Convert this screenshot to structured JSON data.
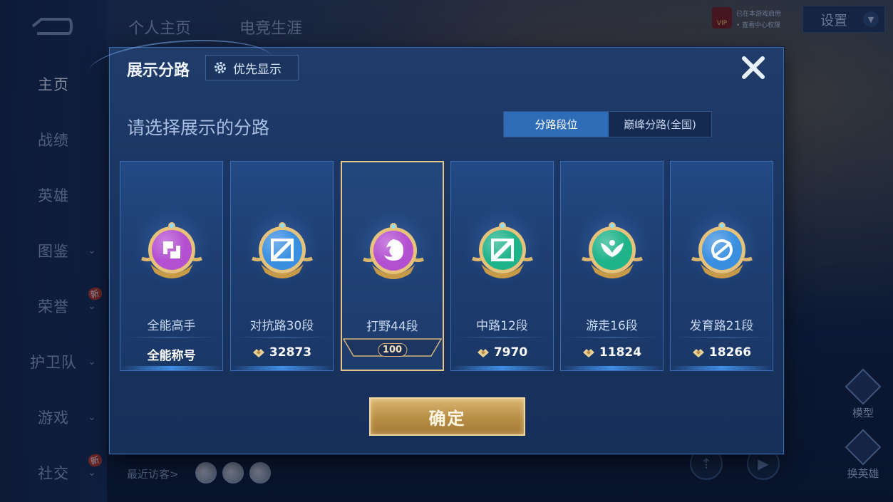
{
  "background": {
    "nav": {
      "items": [
        {
          "label": "主页",
          "active": true,
          "chevron": false,
          "new": false
        },
        {
          "label": "战绩",
          "active": false,
          "chevron": false,
          "new": false
        },
        {
          "label": "英雄",
          "active": false,
          "chevron": false,
          "new": false
        },
        {
          "label": "图鉴",
          "active": false,
          "chevron": true,
          "new": false
        },
        {
          "label": "荣誉",
          "active": false,
          "chevron": true,
          "new": true
        },
        {
          "label": "护卫队",
          "active": false,
          "chevron": true,
          "new": false
        },
        {
          "label": "游戏",
          "active": false,
          "chevron": true,
          "new": false
        },
        {
          "label": "社交",
          "active": false,
          "chevron": true,
          "new": true
        }
      ],
      "new_badge": "新"
    },
    "top_tabs": [
      "个人主页",
      "电竞生涯"
    ],
    "settings_label": "设置",
    "vip": {
      "badge": "VIP",
      "line1": "已在本游戏启用",
      "line2": "• 查看中心权限"
    },
    "recent_visitors_label": "最近访客>",
    "right_buttons": {
      "model": "模型",
      "switch_hero": "换英雄"
    }
  },
  "modal": {
    "title": "展示分路",
    "priority_button": "优先显示",
    "subtitle": "请选择展示的分路",
    "segments": {
      "active": "分路段位",
      "inactive": "巅峰分路(全国)"
    },
    "cards": [
      {
        "name": "全能高手",
        "footer": "全能称号",
        "has_gem": false,
        "selected": false,
        "icon": "allround-icon",
        "color": "#b34fd1"
      },
      {
        "name": "对抗路30段",
        "footer": "32873",
        "has_gem": true,
        "selected": false,
        "icon": "clash-lane-icon",
        "color": "#3a8fe0"
      },
      {
        "name": "打野44段",
        "footer": "100",
        "has_gem": false,
        "selected": true,
        "icon": "jungle-icon",
        "color": "#b34fd1"
      },
      {
        "name": "中路12段",
        "footer": "7970",
        "has_gem": true,
        "selected": false,
        "icon": "mid-lane-icon",
        "color": "#1fb38a"
      },
      {
        "name": "游走16段",
        "footer": "11824",
        "has_gem": true,
        "selected": false,
        "icon": "roam-icon",
        "color": "#1fb38a"
      },
      {
        "name": "发育路21段",
        "footer": "18266",
        "has_gem": true,
        "selected": false,
        "icon": "farm-lane-icon",
        "color": "#3a8fe0"
      }
    ],
    "confirm_label": "确定"
  }
}
